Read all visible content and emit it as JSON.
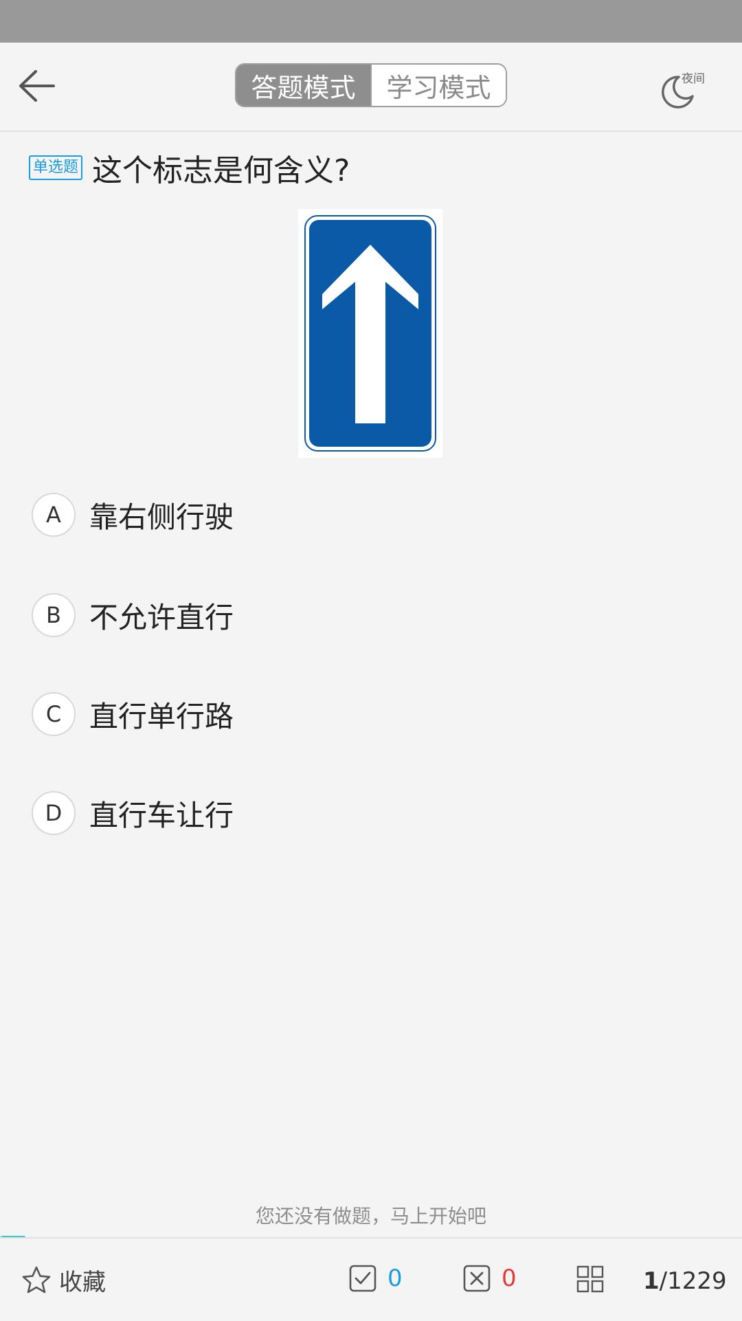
{
  "header": {
    "tabs": [
      {
        "label": "答题模式",
        "active": true
      },
      {
        "label": "学习模式",
        "active": false
      }
    ],
    "night_label": "夜间"
  },
  "question": {
    "type_tag": "单选题",
    "text": "这个标志是何含义?",
    "options": [
      {
        "letter": "A",
        "text": "靠右侧行驶"
      },
      {
        "letter": "B",
        "text": "不允许直行"
      },
      {
        "letter": "C",
        "text": "直行单行路"
      },
      {
        "letter": "D",
        "text": "直行车让行"
      }
    ]
  },
  "hint": "您还没有做题，马上开始吧",
  "footer": {
    "favorite_label": "收藏",
    "correct_count": "0",
    "wrong_count": "0",
    "current": "1",
    "total": "/1229"
  },
  "colors": {
    "accent": "#1a9de0",
    "wrong": "#e53935",
    "sign_blue": "#0a5aa8"
  }
}
